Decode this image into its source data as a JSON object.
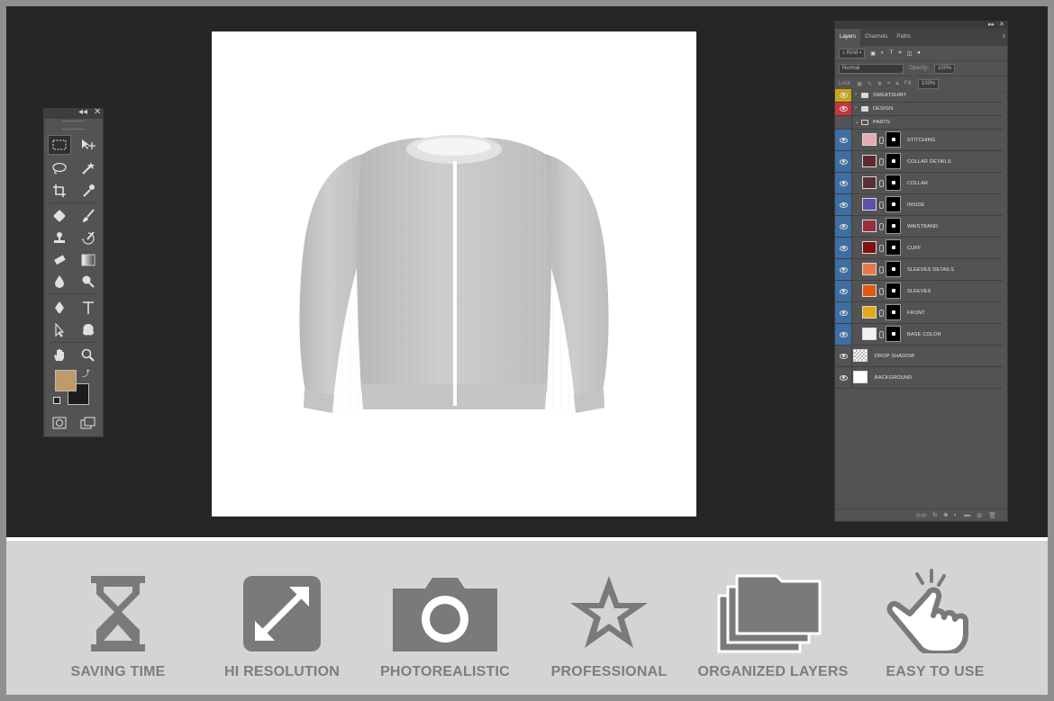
{
  "tools": {
    "foreground_color": "#bf9a6a",
    "background_color": "#1c1c1c"
  },
  "layers_panel": {
    "tabs": [
      "Layers",
      "Channels",
      "Paths"
    ],
    "filter_label": "Kind",
    "blend_mode": "Normal",
    "opacity_label": "Opacity:",
    "opacity_value": "100%",
    "lock_label": "Lock:",
    "fill_label": "Fill:",
    "fill_value": "100%",
    "layers": [
      {
        "name": "SWEATSHIRT",
        "type": "group",
        "tag": "#c8a21a",
        "expanded": false
      },
      {
        "name": "DESIGN",
        "type": "group",
        "tag": "#c9363a",
        "expanded": false
      },
      {
        "name": "PARTS",
        "type": "group",
        "tag": "#535353",
        "expanded": true
      },
      {
        "name": "STITCHING",
        "type": "layer",
        "tag": "#3f6ea3",
        "color": "#e8aab2"
      },
      {
        "name": "COLLAR DETAILS",
        "type": "layer",
        "tag": "#3f6ea3",
        "color": "#5a2a30"
      },
      {
        "name": "COLLAR",
        "type": "layer",
        "tag": "#3f6ea3",
        "color": "#5a2e35"
      },
      {
        "name": "INSIDE",
        "type": "layer",
        "tag": "#3f6ea3",
        "color": "#5f4fa8"
      },
      {
        "name": "WAISTBAND",
        "type": "layer",
        "tag": "#3f6ea3",
        "color": "#96303c"
      },
      {
        "name": "CUFF",
        "type": "layer",
        "tag": "#3f6ea3",
        "color": "#7d1010"
      },
      {
        "name": "SLEEVES DETAILS",
        "type": "layer",
        "tag": "#3f6ea3",
        "color": "#e47a4a"
      },
      {
        "name": "SLEEVES",
        "type": "layer",
        "tag": "#3f6ea3",
        "color": "#e25810"
      },
      {
        "name": "FRONT",
        "type": "layer",
        "tag": "#3f6ea3",
        "color": "#e3aa1a"
      },
      {
        "name": "BASE COLOR",
        "type": "layer",
        "tag": "#3f6ea3",
        "color": "#f2f2f2"
      },
      {
        "name": "DROP SHADOW",
        "type": "layer",
        "tag": "#535353",
        "color": "checker"
      },
      {
        "name": "BACKGROUND",
        "type": "layer",
        "tag": "#535353",
        "color": "#ffffff"
      }
    ]
  },
  "features": [
    {
      "label": "SAVING TIME",
      "icon": "hourglass-icon"
    },
    {
      "label": "HI RESOLUTION",
      "icon": "expand-arrows-icon"
    },
    {
      "label": "PHOTOREALISTIC",
      "icon": "camera-icon"
    },
    {
      "label": "PROFESSIONAL",
      "icon": "star-icon"
    },
    {
      "label": "ORGANIZED LAYERS",
      "icon": "folders-icon"
    },
    {
      "label": "EASY TO USE",
      "icon": "hand-pointer-icon"
    }
  ],
  "colors": {
    "workspace": "#262626",
    "panel": "#535353",
    "icon_gray": "#7a7a7a",
    "bottom_band": "#d4d4d4"
  }
}
